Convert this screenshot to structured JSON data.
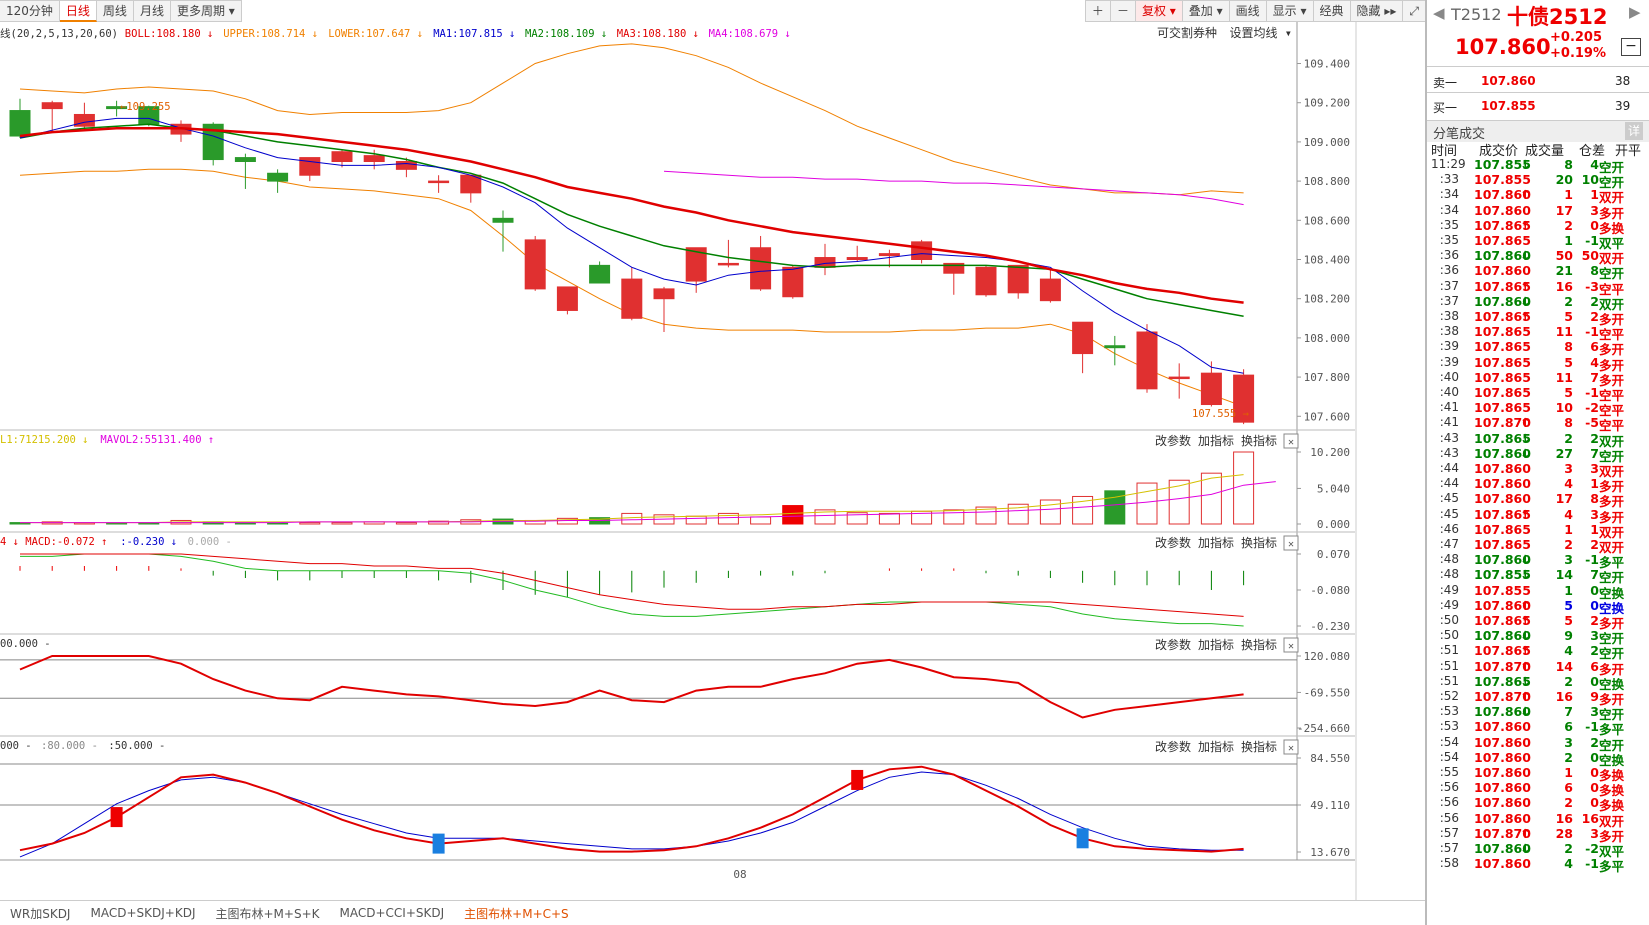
{
  "toolbar": {
    "tabs": [
      {
        "label": "120分钟",
        "active": false
      },
      {
        "label": "日线",
        "active": true
      },
      {
        "label": "周线",
        "active": false
      },
      {
        "label": "月线",
        "active": false
      },
      {
        "label": "更多周期 ▾",
        "active": false
      }
    ],
    "right": [
      "＋",
      "－",
      "复权 ▾",
      "叠加 ▾",
      "画线",
      "显示 ▾",
      "经典",
      "隐藏 ▸▸",
      "⤢"
    ]
  },
  "main": {
    "header": [
      {
        "t": "线(20,2,5,13,20,60)",
        "c": "#333"
      },
      {
        "t": "BOLL:108.180 ↓",
        "c": "#e00000"
      },
      {
        "t": "UPPER:108.714 ↓",
        "c": "#f08000"
      },
      {
        "t": "LOWER:107.647 ↓",
        "c": "#f08000"
      },
      {
        "t": "MA1:107.815 ↓",
        "c": "#0000cc"
      },
      {
        "t": "MA2:108.109 ↓",
        "c": "#008000"
      },
      {
        "t": "MA3:108.180 ↓",
        "c": "#e00000"
      },
      {
        "t": "MA4:108.679 ↓",
        "c": "#e000e0"
      }
    ],
    "links": [
      "可交割券种",
      "设置均线 ▾"
    ],
    "yticks": [
      "109.400",
      "109.200",
      "109.000",
      "108.800",
      "108.600",
      "108.400",
      "108.200",
      "108.000",
      "107.800",
      "107.600"
    ],
    "hi_label": "←109.255",
    "lo_label": "107.555 →"
  },
  "vol": {
    "header": [
      {
        "t": "L1:71215.200 ↓",
        "c": "#d4c000"
      },
      {
        "t": "MAVOL2:55131.400 ↑",
        "c": "#e000e0"
      }
    ],
    "yticks": [
      "10.200",
      "5.040",
      "0.000"
    ]
  },
  "macd": {
    "header": [
      {
        "t": "4 ↓ MACD:-0.072 ↑",
        "c": "#e00000"
      },
      {
        "t": ":-0.230 ↓",
        "c": "#0000cc"
      },
      {
        "t": "0.000 -",
        "c": "#aaa"
      }
    ],
    "yticks": [
      "0.070",
      "-0.080",
      "-0.230"
    ]
  },
  "cci": {
    "header": [
      {
        "t": "00.000 -",
        "c": "#333"
      }
    ],
    "yticks": [
      "120.080",
      "-69.550",
      "-254.660"
    ]
  },
  "kdj": {
    "header": [
      {
        "t": "000 -",
        "c": "#333"
      },
      {
        "t": ":80.000 -",
        "c": "#888"
      },
      {
        "t": ":50.000 -",
        "c": "#333"
      }
    ],
    "yticks": [
      "84.550",
      "49.110",
      "13.670"
    ]
  },
  "panel_buttons": [
    "改参数",
    "加指标",
    "换指标"
  ],
  "close_icon": "✕",
  "date_label": "08",
  "bottom_tabs": [
    {
      "label": "WR加SKDJ",
      "active": false
    },
    {
      "label": "MACD+SKDJ+KDJ",
      "active": false
    },
    {
      "label": "主图布林+M+S+K",
      "active": false
    },
    {
      "label": "MACD+CCI+SKDJ",
      "active": false
    },
    {
      "label": "主图布林+M+C+S",
      "active": true
    }
  ],
  "quote": {
    "code": "T2512",
    "name": "十债2512",
    "price": "107.860",
    "change": "+0.205",
    "pct": "+0.19%",
    "sell_label": "卖一",
    "sell_price": "107.860",
    "sell_vol": "38",
    "buy_label": "买一",
    "buy_price": "107.855",
    "buy_vol": "39",
    "trades_title": "分笔成交",
    "trades_detail": "详",
    "cols": [
      "时间",
      "成交价",
      "成交量",
      "仓差",
      "开平"
    ]
  },
  "trades": [
    [
      "11:29",
      "107.855",
      "↓",
      "8",
      "4",
      "空开",
      "g"
    ],
    [
      ":33",
      "107.855",
      "",
      "20",
      "10",
      "空开",
      "g"
    ],
    [
      ":34",
      "107.860",
      "↑",
      "1",
      "1",
      "双开",
      "r"
    ],
    [
      ":34",
      "107.860",
      "",
      "17",
      "3",
      "多开",
      "r"
    ],
    [
      ":35",
      "107.865",
      "↑",
      "2",
      "0",
      "多换",
      "r"
    ],
    [
      ":35",
      "107.865",
      "",
      "1",
      "-1",
      "双平",
      "g"
    ],
    [
      ":36",
      "107.860",
      "↓",
      "50",
      "50",
      "双开",
      "r"
    ],
    [
      ":36",
      "107.860",
      "",
      "21",
      "8",
      "空开",
      "g"
    ],
    [
      ":37",
      "107.865",
      "↑",
      "16",
      "-3",
      "空平",
      "r"
    ],
    [
      ":37",
      "107.860",
      "↓",
      "2",
      "2",
      "双开",
      "g"
    ],
    [
      ":38",
      "107.865",
      "↑",
      "5",
      "2",
      "多开",
      "r"
    ],
    [
      ":38",
      "107.865",
      "",
      "11",
      "-1",
      "空平",
      "r"
    ],
    [
      ":39",
      "107.865",
      "",
      "8",
      "6",
      "多开",
      "r"
    ],
    [
      ":39",
      "107.865",
      "",
      "5",
      "4",
      "多开",
      "r"
    ],
    [
      ":40",
      "107.865",
      "",
      "11",
      "7",
      "多开",
      "r"
    ],
    [
      ":40",
      "107.865",
      "",
      "5",
      "-1",
      "空平",
      "r"
    ],
    [
      ":41",
      "107.865",
      "",
      "10",
      "-2",
      "空平",
      "r"
    ],
    [
      ":41",
      "107.870",
      "↑",
      "8",
      "-5",
      "空平",
      "r"
    ],
    [
      ":43",
      "107.865",
      "↓",
      "2",
      "2",
      "双开",
      "g"
    ],
    [
      ":43",
      "107.860",
      "↓",
      "27",
      "7",
      "空开",
      "g"
    ],
    [
      ":44",
      "107.860",
      "",
      "3",
      "3",
      "双开",
      "r"
    ],
    [
      ":44",
      "107.860",
      "",
      "4",
      "1",
      "多开",
      "r"
    ],
    [
      ":45",
      "107.860",
      "",
      "17",
      "8",
      "多开",
      "r"
    ],
    [
      ":45",
      "107.865",
      "↑",
      "4",
      "3",
      "多开",
      "r"
    ],
    [
      ":46",
      "107.865",
      "",
      "1",
      "1",
      "双开",
      "r"
    ],
    [
      ":47",
      "107.865",
      "",
      "2",
      "2",
      "双开",
      "r"
    ],
    [
      ":48",
      "107.860",
      "↓",
      "3",
      "-1",
      "多平",
      "g"
    ],
    [
      ":48",
      "107.855",
      "↓",
      "14",
      "7",
      "空开",
      "g"
    ],
    [
      ":49",
      "107.855",
      "",
      "1",
      "0",
      "空换",
      "g"
    ],
    [
      ":49",
      "107.860",
      "↑",
      "5",
      "0",
      "空换",
      "b"
    ],
    [
      ":50",
      "107.865",
      "↑",
      "5",
      "2",
      "多开",
      "r"
    ],
    [
      ":50",
      "107.860",
      "↓",
      "9",
      "3",
      "空开",
      "g"
    ],
    [
      ":51",
      "107.865",
      "↑",
      "4",
      "2",
      "空开",
      "g"
    ],
    [
      ":51",
      "107.870",
      "↑",
      "14",
      "6",
      "多开",
      "r"
    ],
    [
      ":51",
      "107.865",
      "↓",
      "2",
      "0",
      "空换",
      "g"
    ],
    [
      ":52",
      "107.870",
      "↑",
      "16",
      "9",
      "多开",
      "r"
    ],
    [
      ":53",
      "107.860",
      "↓",
      "7",
      "3",
      "空开",
      "g"
    ],
    [
      ":53",
      "107.860",
      "",
      "6",
      "-1",
      "多平",
      "g"
    ],
    [
      ":54",
      "107.860",
      "",
      "3",
      "2",
      "空开",
      "g"
    ],
    [
      ":54",
      "107.860",
      "",
      "2",
      "0",
      "空换",
      "g"
    ],
    [
      ":55",
      "107.860",
      "",
      "1",
      "0",
      "多换",
      "r"
    ],
    [
      ":56",
      "107.860",
      "",
      "6",
      "0",
      "多换",
      "r"
    ],
    [
      ":56",
      "107.860",
      "",
      "2",
      "0",
      "多换",
      "r"
    ],
    [
      ":56",
      "107.860",
      "",
      "16",
      "16",
      "双开",
      "r"
    ],
    [
      ":57",
      "107.870",
      "↑",
      "28",
      "3",
      "多开",
      "r"
    ],
    [
      ":57",
      "107.860",
      "↓",
      "2",
      "-2",
      "双平",
      "g"
    ],
    [
      ":58",
      "107.860",
      "",
      "4",
      "-1",
      "多平",
      "g"
    ]
  ],
  "chart_data": {
    "type": "candlestick",
    "ohlc": [
      [
        109.16,
        109.22,
        109.02,
        109.03
      ],
      [
        109.17,
        109.21,
        109.05,
        109.2
      ],
      [
        109.08,
        109.2,
        109.06,
        109.14
      ],
      [
        109.18,
        109.21,
        109.13,
        109.17
      ],
      [
        109.18,
        109.185,
        109.08,
        109.09
      ],
      [
        109.04,
        109.11,
        109.0,
        109.09
      ],
      [
        109.09,
        109.1,
        108.88,
        108.91
      ],
      [
        108.92,
        108.94,
        108.76,
        108.9
      ],
      [
        108.84,
        108.86,
        108.74,
        108.8
      ],
      [
        108.83,
        108.91,
        108.8,
        108.92
      ],
      [
        108.9,
        108.96,
        108.87,
        108.95
      ],
      [
        108.9,
        108.96,
        108.86,
        108.93
      ],
      [
        108.86,
        108.92,
        108.82,
        108.9
      ],
      [
        108.8,
        108.83,
        108.74,
        108.8
      ],
      [
        108.74,
        108.83,
        108.69,
        108.83
      ],
      [
        108.61,
        108.65,
        108.44,
        108.59
      ],
      [
        108.25,
        108.52,
        108.24,
        108.5
      ],
      [
        108.14,
        108.23,
        108.12,
        108.26
      ],
      [
        108.37,
        108.39,
        108.29,
        108.28
      ],
      [
        108.1,
        108.36,
        108.09,
        108.3
      ],
      [
        108.2,
        108.26,
        108.03,
        108.25
      ],
      [
        108.29,
        108.46,
        108.23,
        108.46
      ],
      [
        108.38,
        108.5,
        108.36,
        108.38
      ],
      [
        108.25,
        108.52,
        108.24,
        108.46
      ],
      [
        108.21,
        108.37,
        108.2,
        108.36
      ],
      [
        108.36,
        108.48,
        108.32,
        108.41
      ],
      [
        108.4,
        108.47,
        108.39,
        108.41
      ],
      [
        108.42,
        108.45,
        108.36,
        108.43
      ],
      [
        108.4,
        108.5,
        108.38,
        108.49
      ],
      [
        108.33,
        108.38,
        108.22,
        108.38
      ],
      [
        108.22,
        108.37,
        108.21,
        108.36
      ],
      [
        108.23,
        108.37,
        108.2,
        108.37
      ],
      [
        108.19,
        108.35,
        108.18,
        108.3
      ],
      [
        107.92,
        108.05,
        107.82,
        108.08
      ],
      [
        107.96,
        108.01,
        107.86,
        107.95
      ],
      [
        107.74,
        108.07,
        107.72,
        108.03
      ],
      [
        107.8,
        107.87,
        107.69,
        107.8
      ],
      [
        107.66,
        107.88,
        107.65,
        107.82
      ],
      [
        107.57,
        107.84,
        107.56,
        107.81
      ]
    ],
    "up": [
      109.27,
      109.26,
      109.25,
      109.27,
      109.28,
      109.27,
      109.26,
      109.22,
      109.16,
      109.14,
      109.15,
      109.15,
      109.15,
      109.16,
      109.2,
      109.3,
      109.4,
      109.45,
      109.49,
      109.5,
      109.48,
      109.44,
      109.38,
      109.3,
      109.23,
      109.16,
      109.08,
      109.02,
      108.96,
      108.9,
      108.86,
      108.82,
      108.78,
      108.76,
      108.74,
      108.74,
      108.73,
      108.75,
      108.74
    ],
    "lo": [
      108.83,
      108.84,
      108.85,
      108.85,
      108.86,
      108.86,
      108.85,
      108.82,
      108.8,
      108.77,
      108.76,
      108.75,
      108.73,
      108.71,
      108.65,
      108.52,
      108.38,
      108.29,
      108.2,
      108.12,
      108.07,
      108.05,
      108.04,
      108.04,
      108.04,
      108.03,
      108.03,
      108.03,
      108.04,
      108.04,
      108.05,
      108.05,
      108.07,
      108.02,
      107.92,
      107.84,
      107.77,
      107.71,
      107.65
    ],
    "ma1": [
      109.02,
      109.06,
      109.1,
      109.12,
      109.12,
      109.07,
      109.03,
      108.97,
      108.92,
      108.9,
      108.88,
      108.88,
      108.89,
      108.87,
      108.83,
      108.77,
      108.69,
      108.56,
      108.46,
      108.36,
      108.3,
      108.27,
      108.32,
      108.34,
      108.35,
      108.38,
      108.39,
      108.41,
      108.43,
      108.42,
      108.41,
      108.39,
      108.36,
      108.24,
      108.13,
      108.04,
      107.96,
      107.85,
      107.82
    ],
    "ma2": [
      109.02,
      109.05,
      109.07,
      109.08,
      109.09,
      109.07,
      109.06,
      109.03,
      109.0,
      108.98,
      108.96,
      108.94,
      108.91,
      108.87,
      108.84,
      108.79,
      108.71,
      108.63,
      108.57,
      108.52,
      108.47,
      108.44,
      108.41,
      108.39,
      108.37,
      108.36,
      108.37,
      108.37,
      108.37,
      108.37,
      108.37,
      108.36,
      108.35,
      108.3,
      108.25,
      108.2,
      108.17,
      108.14,
      108.11
    ],
    "ma3": [
      109.03,
      109.05,
      109.06,
      109.07,
      109.07,
      109.07,
      109.06,
      109.05,
      109.04,
      109.02,
      109.0,
      108.98,
      108.96,
      108.93,
      108.9,
      108.86,
      108.82,
      108.77,
      108.74,
      108.71,
      108.67,
      108.64,
      108.6,
      108.57,
      108.54,
      108.52,
      108.5,
      108.48,
      108.46,
      108.44,
      108.42,
      108.39,
      108.35,
      108.32,
      108.28,
      108.25,
      108.23,
      108.2,
      108.18
    ],
    "ma4": [
      null,
      null,
      null,
      null,
      null,
      null,
      null,
      null,
      null,
      null,
      null,
      null,
      null,
      null,
      null,
      null,
      null,
      null,
      null,
      null,
      108.85,
      108.84,
      108.83,
      108.82,
      108.82,
      108.81,
      108.81,
      108.8,
      108.8,
      108.79,
      108.79,
      108.78,
      108.77,
      108.76,
      108.75,
      108.74,
      108.73,
      108.71,
      108.68
    ],
    "vol": [
      0.2,
      0.3,
      0.2,
      0.1,
      0.2,
      0.5,
      0.3,
      0.2,
      0.1,
      0.2,
      0.2,
      0.3,
      0.2,
      0.4,
      0.6,
      0.7,
      0.5,
      0.8,
      0.9,
      1.5,
      1.3,
      1.1,
      1.5,
      1.0,
      2.6,
      2.0,
      1.6,
      1.5,
      1.8,
      2.0,
      2.4,
      2.8,
      3.4,
      3.9,
      4.7,
      5.8,
      6.2,
      7.2,
      10.2,
      6.0
    ],
    "mavol1": [
      0.2,
      0.2,
      0.2,
      0.2,
      0.2,
      0.3,
      0.3,
      0.3,
      0.3,
      0.3,
      0.3,
      0.3,
      0.3,
      0.3,
      0.4,
      0.5,
      0.5,
      0.6,
      0.7,
      0.9,
      1.0,
      1.1,
      1.2,
      1.3,
      1.5,
      1.7,
      1.8,
      1.8,
      1.8,
      1.9,
      2.1,
      2.3,
      2.7,
      3.2,
      3.8,
      4.6,
      5.4,
      6.5,
      7.0
    ],
    "mavol2": [
      0.2,
      0.2,
      0.2,
      0.2,
      0.2,
      0.2,
      0.2,
      0.2,
      0.2,
      0.3,
      0.3,
      0.3,
      0.3,
      0.3,
      0.3,
      0.4,
      0.4,
      0.5,
      0.5,
      0.6,
      0.7,
      0.8,
      0.9,
      1.0,
      1.1,
      1.2,
      1.3,
      1.4,
      1.5,
      1.6,
      1.7,
      1.9,
      2.1,
      2.4,
      2.7,
      3.1,
      3.6,
      4.2,
      5.5,
      6.0
    ],
    "macd_hist": [
      0.02,
      0.02,
      0.02,
      0.02,
      0.02,
      0.01,
      -0.02,
      -0.03,
      -0.04,
      -0.04,
      -0.03,
      -0.03,
      -0.03,
      -0.04,
      -0.05,
      -0.08,
      -0.1,
      -0.11,
      -0.1,
      -0.09,
      -0.07,
      -0.05,
      -0.03,
      -0.02,
      -0.02,
      -0.01,
      0.0,
      0.01,
      0.01,
      0.01,
      -0.01,
      -0.02,
      -0.03,
      -0.05,
      -0.06,
      -0.06,
      -0.06,
      -0.08,
      -0.06
    ],
    "dif": [
      0.06,
      0.06,
      0.07,
      0.07,
      0.07,
      0.06,
      0.04,
      0.01,
      0.0,
      0.0,
      0.0,
      0.0,
      0.0,
      0.0,
      -0.01,
      -0.04,
      -0.08,
      -0.11,
      -0.15,
      -0.18,
      -0.19,
      -0.19,
      -0.18,
      -0.17,
      -0.16,
      -0.15,
      -0.14,
      -0.13,
      -0.13,
      -0.13,
      -0.13,
      -0.14,
      -0.15,
      -0.18,
      -0.2,
      -0.21,
      -0.22,
      -0.22,
      -0.23
    ],
    "dea": [
      0.07,
      0.07,
      0.07,
      0.07,
      0.07,
      0.07,
      0.06,
      0.05,
      0.04,
      0.03,
      0.03,
      0.02,
      0.02,
      0.01,
      0.01,
      -0.01,
      -0.04,
      -0.07,
      -0.1,
      -0.12,
      -0.14,
      -0.15,
      -0.16,
      -0.16,
      -0.15,
      -0.15,
      -0.14,
      -0.14,
      -0.13,
      -0.13,
      -0.13,
      -0.13,
      -0.13,
      -0.14,
      -0.15,
      -0.16,
      -0.17,
      -0.18,
      -0.19
    ],
    "cci": [
      50,
      120,
      120,
      120,
      120,
      80,
      0,
      -60,
      -100,
      -110,
      -40,
      -60,
      -80,
      -90,
      -110,
      -130,
      -140,
      -120,
      -60,
      -110,
      -120,
      -60,
      -40,
      -40,
      0,
      30,
      80,
      100,
      60,
      10,
      0,
      -20,
      -120,
      -200,
      -160,
      -140,
      -120,
      -100,
      -80
    ],
    "kdj_k": [
      15,
      20,
      28,
      40,
      55,
      70,
      72,
      66,
      58,
      48,
      38,
      30,
      24,
      20,
      22,
      24,
      20,
      16,
      14,
      14,
      15,
      18,
      24,
      32,
      42,
      55,
      68,
      76,
      78,
      72,
      60,
      48,
      34,
      24,
      18,
      16,
      15,
      14,
      16
    ],
    "kdj_d": [
      10,
      20,
      35,
      50,
      60,
      68,
      70,
      66,
      58,
      50,
      42,
      35,
      28,
      24,
      24,
      24,
      22,
      20,
      18,
      16,
      16,
      18,
      22,
      28,
      36,
      48,
      60,
      70,
      74,
      72,
      64,
      54,
      42,
      32,
      24,
      18,
      16,
      15,
      15
    ],
    "buy_signals": [
      3,
      26
    ],
    "sell_signals": [
      13,
      33
    ]
  }
}
